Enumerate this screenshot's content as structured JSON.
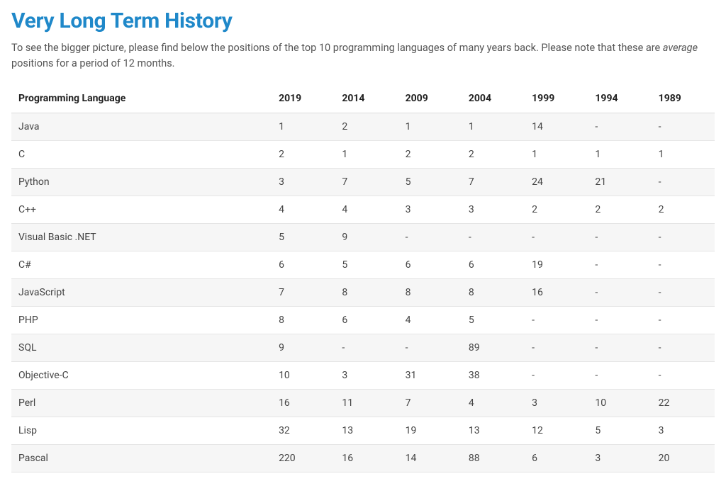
{
  "heading": "Very Long Term History",
  "intro_part1": "To see the bigger picture, please find below the positions of the top 10 programming languages of many years back. Please note that these are ",
  "intro_emph": "average",
  "intro_part2": " positions for a period of 12 months.",
  "chart_data": {
    "type": "table",
    "title": "Very Long Term History",
    "columns": [
      "Programming Language",
      "2019",
      "2014",
      "2009",
      "2004",
      "1999",
      "1994",
      "1989"
    ],
    "rows": [
      {
        "name": "Java",
        "ranks": [
          "1",
          "2",
          "1",
          "1",
          "14",
          "-",
          "-"
        ]
      },
      {
        "name": "C",
        "ranks": [
          "2",
          "1",
          "2",
          "2",
          "1",
          "1",
          "1"
        ]
      },
      {
        "name": "Python",
        "ranks": [
          "3",
          "7",
          "5",
          "7",
          "24",
          "21",
          "-"
        ]
      },
      {
        "name": "C++",
        "ranks": [
          "4",
          "4",
          "3",
          "3",
          "2",
          "2",
          "2"
        ]
      },
      {
        "name": "Visual Basic .NET",
        "ranks": [
          "5",
          "9",
          "-",
          "-",
          "-",
          "-",
          "-"
        ]
      },
      {
        "name": "C#",
        "ranks": [
          "6",
          "5",
          "6",
          "6",
          "19",
          "-",
          "-"
        ]
      },
      {
        "name": "JavaScript",
        "ranks": [
          "7",
          "8",
          "8",
          "8",
          "16",
          "-",
          "-"
        ]
      },
      {
        "name": "PHP",
        "ranks": [
          "8",
          "6",
          "4",
          "5",
          "-",
          "-",
          "-"
        ]
      },
      {
        "name": "SQL",
        "ranks": [
          "9",
          "-",
          "-",
          "89",
          "-",
          "-",
          "-"
        ]
      },
      {
        "name": "Objective-C",
        "ranks": [
          "10",
          "3",
          "31",
          "38",
          "-",
          "-",
          "-"
        ]
      },
      {
        "name": "Perl",
        "ranks": [
          "16",
          "11",
          "7",
          "4",
          "3",
          "10",
          "22"
        ]
      },
      {
        "name": "Lisp",
        "ranks": [
          "32",
          "13",
          "19",
          "13",
          "12",
          "5",
          "3"
        ]
      },
      {
        "name": "Pascal",
        "ranks": [
          "220",
          "16",
          "14",
          "88",
          "6",
          "3",
          "20"
        ]
      }
    ]
  }
}
